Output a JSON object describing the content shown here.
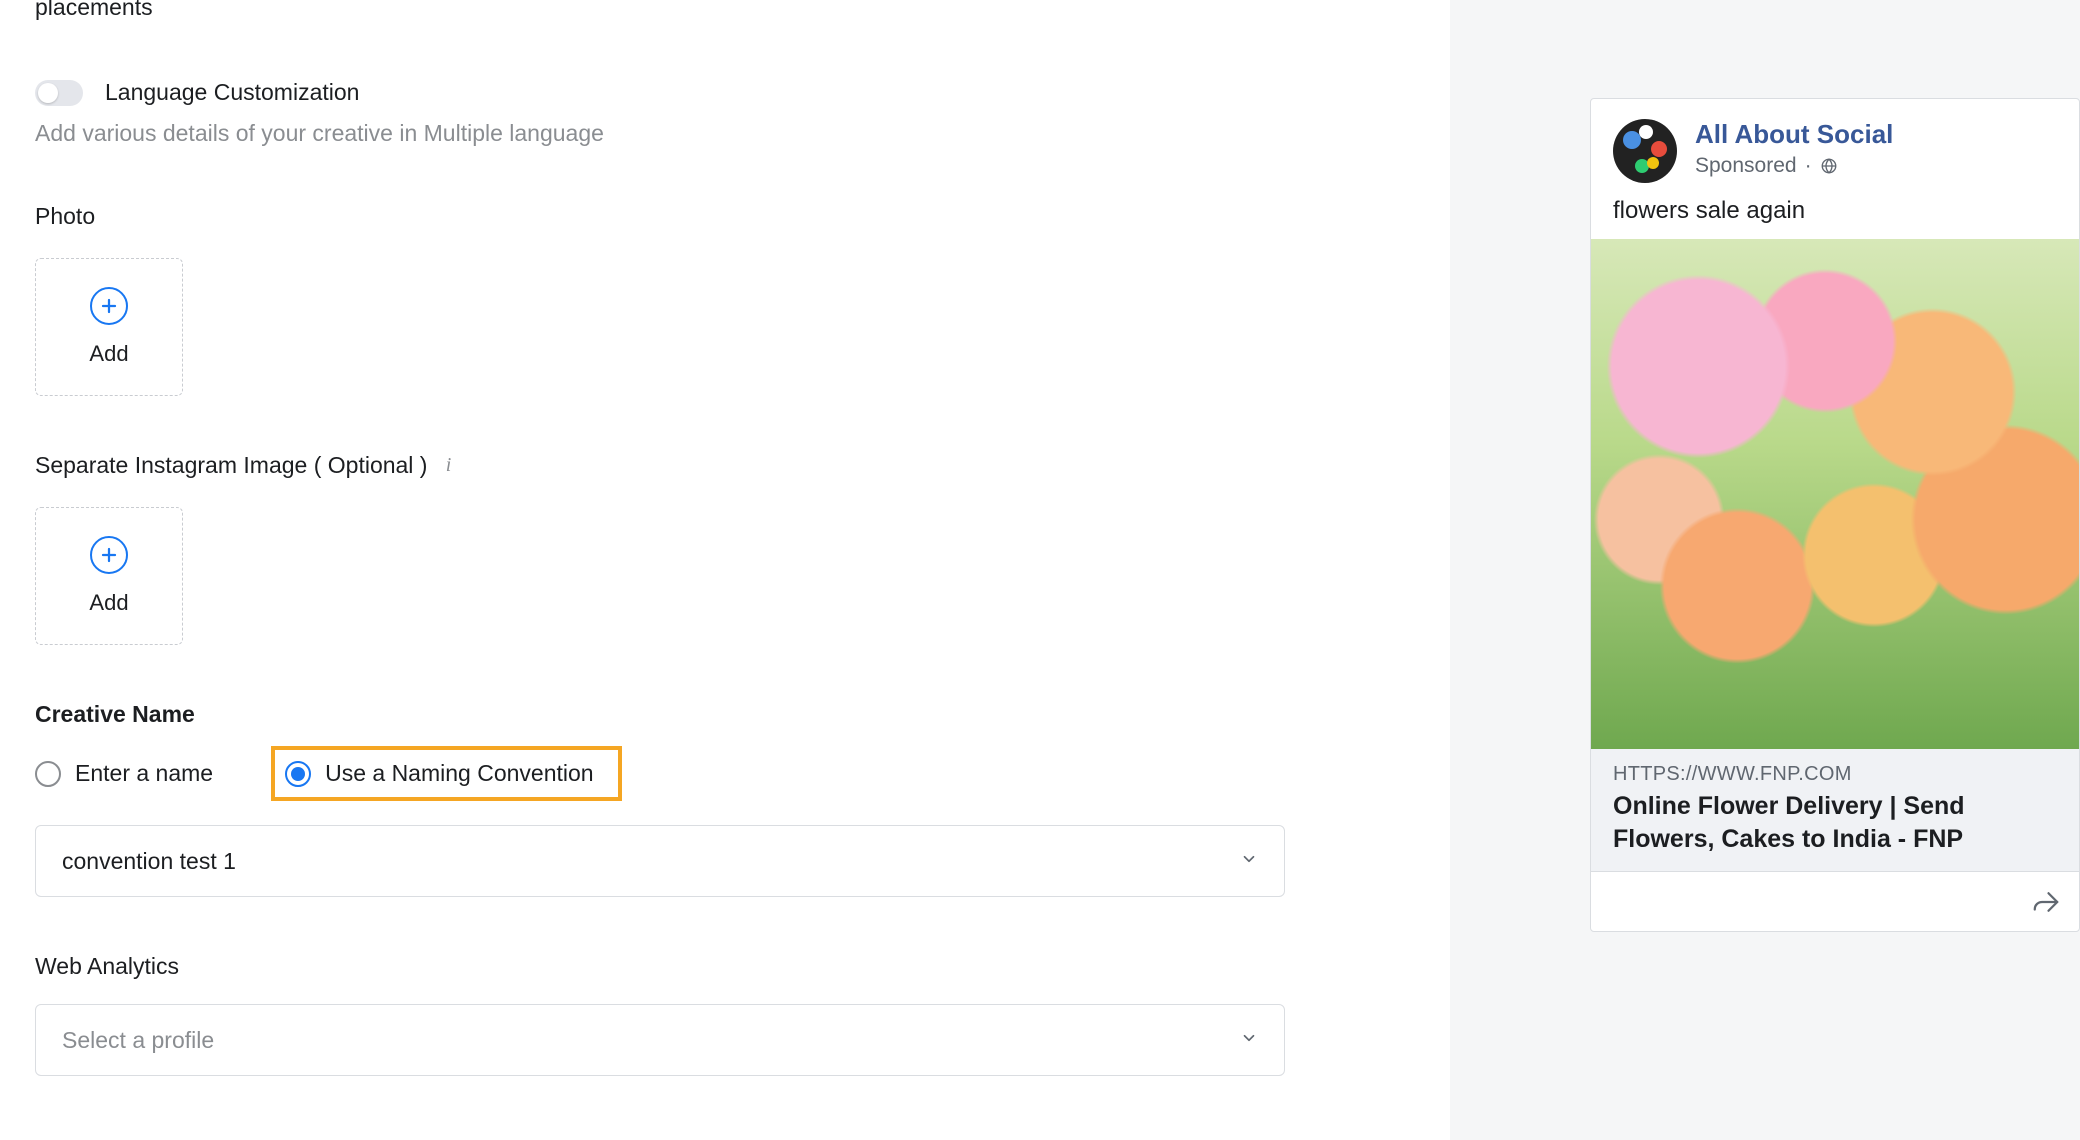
{
  "top_fragment": "placements",
  "language_customization": {
    "label": "Language Customization",
    "helper": "Add various details of your creative in Multiple language"
  },
  "photo": {
    "label": "Photo",
    "add": "Add"
  },
  "instagram_image": {
    "label": "Separate Instagram Image ( Optional )",
    "add": "Add"
  },
  "creative_name": {
    "label": "Creative Name",
    "options": {
      "enter": "Enter a name",
      "convention": "Use a Naming Convention"
    },
    "selected_value": "convention test 1"
  },
  "web_analytics": {
    "label": "Web Analytics",
    "placeholder": "Select a profile"
  },
  "preview": {
    "page_name": "All About Social",
    "sponsored": "Sponsored",
    "dot": "·",
    "body": "flowers sale again",
    "link_domain": "HTTPS://WWW.FNP.COM",
    "link_title": "Online Flower Delivery | Send Flowers, Cakes to India - FNP"
  }
}
